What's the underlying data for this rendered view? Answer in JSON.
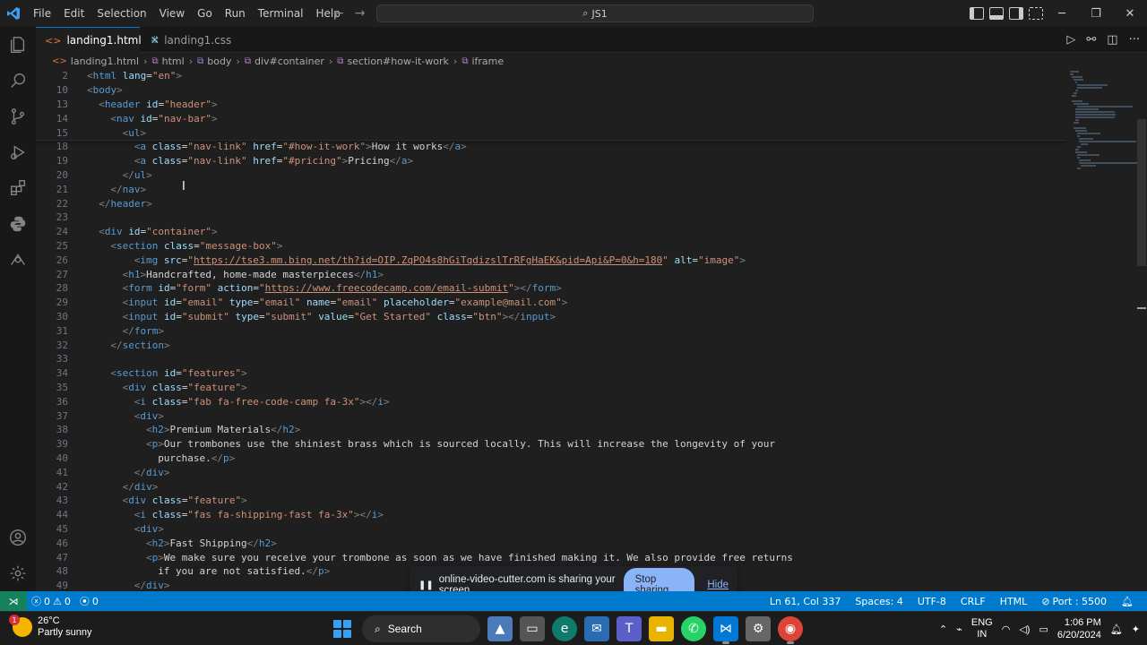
{
  "menu": [
    "File",
    "Edit",
    "Selection",
    "View",
    "Go",
    "Run",
    "Terminal",
    "Help"
  ],
  "search": {
    "text": "JS1"
  },
  "tabs": [
    {
      "label": "landing1.html",
      "icon": "html-file-icon",
      "active": true
    },
    {
      "label": "landing1.css",
      "icon": "css-file-icon",
      "active": false
    }
  ],
  "breadcrumb": [
    "landing1.html",
    "html",
    "body",
    "div#container",
    "section#how-it-work",
    "iframe"
  ],
  "code_lines": [
    {
      "n": "2",
      "indent": 0,
      "tokens": [
        [
          "br",
          "<"
        ],
        [
          "tag",
          "html"
        ],
        [
          "text",
          " "
        ],
        [
          "attr",
          "lang"
        ],
        [
          "text",
          "="
        ],
        [
          "str",
          "\"en\""
        ],
        [
          "br",
          ">"
        ]
      ]
    },
    {
      "n": "10",
      "indent": 0,
      "tokens": [
        [
          "br",
          "<"
        ],
        [
          "tag",
          "body"
        ],
        [
          "br",
          ">"
        ]
      ]
    },
    {
      "n": "13",
      "indent": 1,
      "tokens": [
        [
          "br",
          "<"
        ],
        [
          "tag",
          "header"
        ],
        [
          "text",
          " "
        ],
        [
          "attr",
          "id"
        ],
        [
          "text",
          "="
        ],
        [
          "str",
          "\"header\""
        ],
        [
          "br",
          ">"
        ]
      ]
    },
    {
      "n": "14",
      "indent": 2,
      "tokens": [
        [
          "br",
          "<"
        ],
        [
          "tag",
          "nav"
        ],
        [
          "text",
          " "
        ],
        [
          "attr",
          "id"
        ],
        [
          "text",
          "="
        ],
        [
          "str",
          "\"nav-bar\""
        ],
        [
          "br",
          ">"
        ]
      ]
    },
    {
      "n": "15",
      "indent": 3,
      "tokens": [
        [
          "br",
          "<"
        ],
        [
          "tag",
          "ul"
        ],
        [
          "br",
          ">"
        ]
      ]
    },
    {
      "n": "18",
      "indent": 4,
      "tokens": [
        [
          "br",
          "<"
        ],
        [
          "tag",
          "a"
        ],
        [
          "text",
          " "
        ],
        [
          "attr",
          "class"
        ],
        [
          "text",
          "="
        ],
        [
          "str",
          "\"nav-link\""
        ],
        [
          "text",
          " "
        ],
        [
          "attr",
          "href"
        ],
        [
          "text",
          "="
        ],
        [
          "str",
          "\"#how-it-work\""
        ],
        [
          "br",
          ">"
        ],
        [
          "text",
          "How it works"
        ],
        [
          "br",
          "</"
        ],
        [
          "tag",
          "a"
        ],
        [
          "br",
          ">"
        ]
      ]
    },
    {
      "n": "19",
      "indent": 4,
      "tokens": [
        [
          "br",
          "<"
        ],
        [
          "tag",
          "a"
        ],
        [
          "text",
          " "
        ],
        [
          "attr",
          "class"
        ],
        [
          "text",
          "="
        ],
        [
          "str",
          "\"nav-link\""
        ],
        [
          "text",
          " "
        ],
        [
          "attr",
          "href"
        ],
        [
          "text",
          "="
        ],
        [
          "str",
          "\"#pricing\""
        ],
        [
          "br",
          ">"
        ],
        [
          "text",
          "Pricing"
        ],
        [
          "br",
          "</"
        ],
        [
          "tag",
          "a"
        ],
        [
          "br",
          ">"
        ]
      ]
    },
    {
      "n": "20",
      "indent": 3,
      "tokens": [
        [
          "br",
          "</"
        ],
        [
          "tag",
          "ul"
        ],
        [
          "br",
          ">"
        ]
      ]
    },
    {
      "n": "21",
      "indent": 2,
      "tokens": [
        [
          "br",
          "</"
        ],
        [
          "tag",
          "nav"
        ],
        [
          "br",
          ">"
        ]
      ]
    },
    {
      "n": "22",
      "indent": 1,
      "tokens": [
        [
          "br",
          "</"
        ],
        [
          "tag",
          "header"
        ],
        [
          "br",
          ">"
        ]
      ]
    },
    {
      "n": "23",
      "indent": 0,
      "tokens": []
    },
    {
      "n": "24",
      "indent": 1,
      "tokens": [
        [
          "br",
          "<"
        ],
        [
          "tag",
          "div"
        ],
        [
          "text",
          " "
        ],
        [
          "attr",
          "id"
        ],
        [
          "text",
          "="
        ],
        [
          "str",
          "\"container\""
        ],
        [
          "br",
          ">"
        ]
      ]
    },
    {
      "n": "25",
      "indent": 2,
      "tokens": [
        [
          "br",
          "<"
        ],
        [
          "tag",
          "section"
        ],
        [
          "text",
          " "
        ],
        [
          "attr",
          "class"
        ],
        [
          "text",
          "="
        ],
        [
          "str",
          "\"message-box\""
        ],
        [
          "br",
          ">"
        ]
      ]
    },
    {
      "n": "26",
      "indent": 4,
      "tokens": [
        [
          "br",
          "<"
        ],
        [
          "tag",
          "img"
        ],
        [
          "text",
          " "
        ],
        [
          "attr",
          "src"
        ],
        [
          "text",
          "="
        ],
        [
          "str",
          "\""
        ],
        [
          "url",
          "https://tse3.mm.bing.net/th?id=OIP.ZqPO4s8hGiTqdizslTrRFgHaEK&pid=Api&P=0&h=180"
        ],
        [
          "str",
          "\""
        ],
        [
          "text",
          " "
        ],
        [
          "attr",
          "alt"
        ],
        [
          "text",
          "="
        ],
        [
          "str",
          "\"image\""
        ],
        [
          "br",
          ">"
        ]
      ]
    },
    {
      "n": "27",
      "indent": 3,
      "tokens": [
        [
          "br",
          "<"
        ],
        [
          "tag",
          "h1"
        ],
        [
          "br",
          ">"
        ],
        [
          "text",
          "Handcrafted, home-made masterpieces"
        ],
        [
          "br",
          "</"
        ],
        [
          "tag",
          "h1"
        ],
        [
          "br",
          ">"
        ]
      ]
    },
    {
      "n": "28",
      "indent": 3,
      "tokens": [
        [
          "br",
          "<"
        ],
        [
          "tag",
          "form"
        ],
        [
          "text",
          " "
        ],
        [
          "attr",
          "id"
        ],
        [
          "text",
          "="
        ],
        [
          "str",
          "\"form\""
        ],
        [
          "text",
          " "
        ],
        [
          "attr",
          "action"
        ],
        [
          "text",
          "="
        ],
        [
          "str",
          "\""
        ],
        [
          "url",
          "https://www.freecodecamp.com/email-submit"
        ],
        [
          "str",
          "\""
        ],
        [
          "br",
          "></"
        ],
        [
          "tag",
          "form"
        ],
        [
          "br",
          ">"
        ]
      ]
    },
    {
      "n": "29",
      "indent": 3,
      "tokens": [
        [
          "br",
          "<"
        ],
        [
          "tag",
          "input"
        ],
        [
          "text",
          " "
        ],
        [
          "attr",
          "id"
        ],
        [
          "text",
          "="
        ],
        [
          "str",
          "\"email\""
        ],
        [
          "text",
          " "
        ],
        [
          "attr",
          "type"
        ],
        [
          "text",
          "="
        ],
        [
          "str",
          "\"email\""
        ],
        [
          "text",
          " "
        ],
        [
          "attr",
          "name"
        ],
        [
          "text",
          "="
        ],
        [
          "str",
          "\"email\""
        ],
        [
          "text",
          " "
        ],
        [
          "attr",
          "placeholder"
        ],
        [
          "text",
          "="
        ],
        [
          "str",
          "\"example@mail.com\""
        ],
        [
          "br",
          ">"
        ]
      ]
    },
    {
      "n": "30",
      "indent": 3,
      "tokens": [
        [
          "br",
          "<"
        ],
        [
          "tag",
          "input"
        ],
        [
          "text",
          " "
        ],
        [
          "attr",
          "id"
        ],
        [
          "text",
          "="
        ],
        [
          "str",
          "\"submit\""
        ],
        [
          "text",
          " "
        ],
        [
          "attr",
          "type"
        ],
        [
          "text",
          "="
        ],
        [
          "str",
          "\"submit\""
        ],
        [
          "text",
          " "
        ],
        [
          "attr",
          "value"
        ],
        [
          "text",
          "="
        ],
        [
          "str",
          "\"Get Started\""
        ],
        [
          "text",
          " "
        ],
        [
          "attr",
          "class"
        ],
        [
          "text",
          "="
        ],
        [
          "str",
          "\"btn\""
        ],
        [
          "br",
          "></"
        ],
        [
          "tag",
          "input"
        ],
        [
          "br",
          ">"
        ]
      ]
    },
    {
      "n": "31",
      "indent": 3,
      "tokens": [
        [
          "br",
          "</"
        ],
        [
          "tag",
          "form"
        ],
        [
          "br",
          ">"
        ]
      ]
    },
    {
      "n": "32",
      "indent": 2,
      "tokens": [
        [
          "br",
          "</"
        ],
        [
          "tag",
          "section"
        ],
        [
          "br",
          ">"
        ]
      ]
    },
    {
      "n": "33",
      "indent": 0,
      "tokens": []
    },
    {
      "n": "34",
      "indent": 2,
      "tokens": [
        [
          "br",
          "<"
        ],
        [
          "tag",
          "section"
        ],
        [
          "text",
          " "
        ],
        [
          "attr",
          "id"
        ],
        [
          "text",
          "="
        ],
        [
          "str",
          "\"features\""
        ],
        [
          "br",
          ">"
        ]
      ]
    },
    {
      "n": "35",
      "indent": 3,
      "tokens": [
        [
          "br",
          "<"
        ],
        [
          "tag",
          "div"
        ],
        [
          "text",
          " "
        ],
        [
          "attr",
          "class"
        ],
        [
          "text",
          "="
        ],
        [
          "str",
          "\"feature\""
        ],
        [
          "br",
          ">"
        ]
      ]
    },
    {
      "n": "36",
      "indent": 4,
      "tokens": [
        [
          "br",
          "<"
        ],
        [
          "tag",
          "i"
        ],
        [
          "text",
          " "
        ],
        [
          "attr",
          "class"
        ],
        [
          "text",
          "="
        ],
        [
          "str",
          "\"fab fa-free-code-camp fa-3x\""
        ],
        [
          "br",
          "></"
        ],
        [
          "tag",
          "i"
        ],
        [
          "br",
          ">"
        ]
      ]
    },
    {
      "n": "37",
      "indent": 4,
      "tokens": [
        [
          "br",
          "<"
        ],
        [
          "tag",
          "div"
        ],
        [
          "br",
          ">"
        ]
      ]
    },
    {
      "n": "38",
      "indent": 5,
      "tokens": [
        [
          "br",
          "<"
        ],
        [
          "tag",
          "h2"
        ],
        [
          "br",
          ">"
        ],
        [
          "text",
          "Premium Materials"
        ],
        [
          "br",
          "</"
        ],
        [
          "tag",
          "h2"
        ],
        [
          "br",
          ">"
        ]
      ]
    },
    {
      "n": "39",
      "indent": 5,
      "tokens": [
        [
          "br",
          "<"
        ],
        [
          "tag",
          "p"
        ],
        [
          "br",
          ">"
        ],
        [
          "text",
          "Our trombones use the shiniest brass which is sourced locally. This will increase the longevity of your"
        ]
      ]
    },
    {
      "n": "40",
      "indent": 6,
      "tokens": [
        [
          "text",
          "purchase."
        ],
        [
          "br",
          "</"
        ],
        [
          "tag",
          "p"
        ],
        [
          "br",
          ">"
        ]
      ]
    },
    {
      "n": "41",
      "indent": 4,
      "tokens": [
        [
          "br",
          "</"
        ],
        [
          "tag",
          "div"
        ],
        [
          "br",
          ">"
        ]
      ]
    },
    {
      "n": "42",
      "indent": 3,
      "tokens": [
        [
          "br",
          "</"
        ],
        [
          "tag",
          "div"
        ],
        [
          "br",
          ">"
        ]
      ]
    },
    {
      "n": "43",
      "indent": 3,
      "tokens": [
        [
          "br",
          "<"
        ],
        [
          "tag",
          "div"
        ],
        [
          "text",
          " "
        ],
        [
          "attr",
          "class"
        ],
        [
          "text",
          "="
        ],
        [
          "str",
          "\"feature\""
        ],
        [
          "br",
          ">"
        ]
      ]
    },
    {
      "n": "44",
      "indent": 4,
      "tokens": [
        [
          "br",
          "<"
        ],
        [
          "tag",
          "i"
        ],
        [
          "text",
          " "
        ],
        [
          "attr",
          "class"
        ],
        [
          "text",
          "="
        ],
        [
          "str",
          "\"fas fa-shipping-fast fa-3x\""
        ],
        [
          "br",
          "></"
        ],
        [
          "tag",
          "i"
        ],
        [
          "br",
          ">"
        ]
      ]
    },
    {
      "n": "45",
      "indent": 4,
      "tokens": [
        [
          "br",
          "<"
        ],
        [
          "tag",
          "div"
        ],
        [
          "br",
          ">"
        ]
      ]
    },
    {
      "n": "46",
      "indent": 5,
      "tokens": [
        [
          "br",
          "<"
        ],
        [
          "tag",
          "h2"
        ],
        [
          "br",
          ">"
        ],
        [
          "text",
          "Fast Shipping"
        ],
        [
          "br",
          "</"
        ],
        [
          "tag",
          "h2"
        ],
        [
          "br",
          ">"
        ]
      ]
    },
    {
      "n": "47",
      "indent": 5,
      "tokens": [
        [
          "br",
          "<"
        ],
        [
          "tag",
          "p"
        ],
        [
          "br",
          ">"
        ],
        [
          "text",
          "We make sure you receive your trombone as soon as we have finished making it. We also provide free returns"
        ]
      ]
    },
    {
      "n": "48",
      "indent": 6,
      "tokens": [
        [
          "text",
          "if you are not satisfied."
        ],
        [
          "br",
          "</"
        ],
        [
          "tag",
          "p"
        ],
        [
          "br",
          ">"
        ]
      ]
    },
    {
      "n": "49",
      "indent": 4,
      "tokens": [
        [
          "br",
          "</"
        ],
        [
          "tag",
          "div"
        ],
        [
          "br",
          ">"
        ]
      ]
    }
  ],
  "share_banner": {
    "message": "online-video-cutter.com is sharing your screen.",
    "stop_label": "Stop sharing",
    "hide_label": "Hide"
  },
  "status": {
    "errors": "0",
    "warnings": "0",
    "ports": "0",
    "position": "Ln 61, Col 337",
    "spaces": "Spaces: 4",
    "encoding": "UTF-8",
    "eol": "CRLF",
    "language": "HTML",
    "port": "Port : 5500"
  },
  "taskbar": {
    "weather_badge": "1",
    "temperature": "26°C",
    "condition": "Partly sunny",
    "search_label": "Search",
    "lang_top": "ENG",
    "lang_bottom": "IN",
    "time": "1:06 PM",
    "date": "6/20/2024"
  },
  "colors": {
    "accent": "#0078d4",
    "statusbar": "#007acc",
    "remote": "#16825d"
  }
}
